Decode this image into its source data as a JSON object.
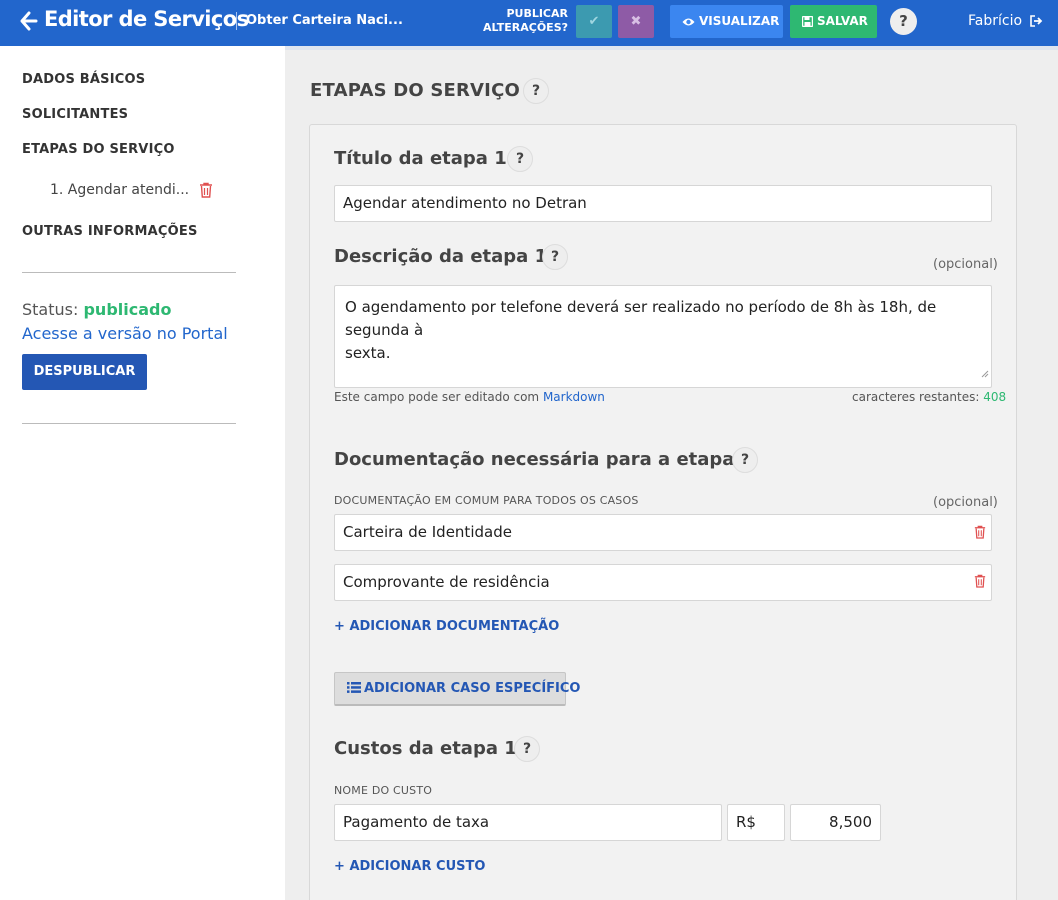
{
  "header": {
    "back_icon": "arrow-left-icon",
    "app_title": "Editor de Serviços",
    "service_name": "Obter Carteira Naci...",
    "publish_label_line1": "PUBLICAR",
    "publish_label_line2": "ALTERAÇÕES?",
    "confirm_glyph": "✔",
    "cancel_glyph": "✖",
    "view_label": "VISUALIZAR",
    "save_label": "SALVAR",
    "help_glyph": "?",
    "user_name": "Fabrício",
    "colors": {
      "bar": "#2266cc",
      "view": "#3b86f0",
      "save": "#2eb872",
      "confirm": "#3c9ab0",
      "cancel": "#8e5ba6"
    }
  },
  "sidebar": {
    "items": [
      {
        "label": "DADOS BÁSICOS"
      },
      {
        "label": "SOLICITANTES"
      },
      {
        "label": "ETAPAS DO SERVIÇO"
      },
      {
        "label": "OUTRAS INFORMAÇÕES"
      }
    ],
    "sub_item": "1. Agendar atendi...",
    "status_label": "Status:",
    "status_value": "publicado",
    "portal_link": "Acesse a versão no Portal",
    "unpublish_label": "DESPUBLICAR"
  },
  "main": {
    "section_title": "ETAPAS DO SERVIÇO",
    "help_glyph": "?",
    "step_title_label": "Título da etapa 1",
    "step_title_value": "Agendar atendimento no Detran",
    "desc_label": "Descrição da etapa 1",
    "optional": "(opcional)",
    "desc_line1": "O agendamento por telefone deverá ser realizado no período de 8h às 18h, de segunda à",
    "desc_line2": "sexta.",
    "markdown_hint": "Este campo pode ser editado com",
    "markdown_link": "Markdown",
    "chars_label": "caracteres restantes:",
    "chars_count": "408",
    "docs_label": "Documentação necessária para a etapa 1",
    "docs_common_caption": "DOCUMENTAÇÃO EM COMUM PARA TODOS OS CASOS",
    "docs": [
      "Carteira de Identidade",
      "Comprovante de residência"
    ],
    "add_doc": "ADICIONAR DOCUMENTAÇÃO",
    "add_case": "ADICIONAR CASO ESPECÍFICO",
    "costs_label": "Custos da etapa 1",
    "cost_name_caption": "NOME DO CUSTO",
    "cost_name": "Pagamento de taxa",
    "currency": "R$",
    "cost_value": "8,500",
    "add_cost": "ADICIONAR CUSTO",
    "plus_glyph": "+"
  }
}
